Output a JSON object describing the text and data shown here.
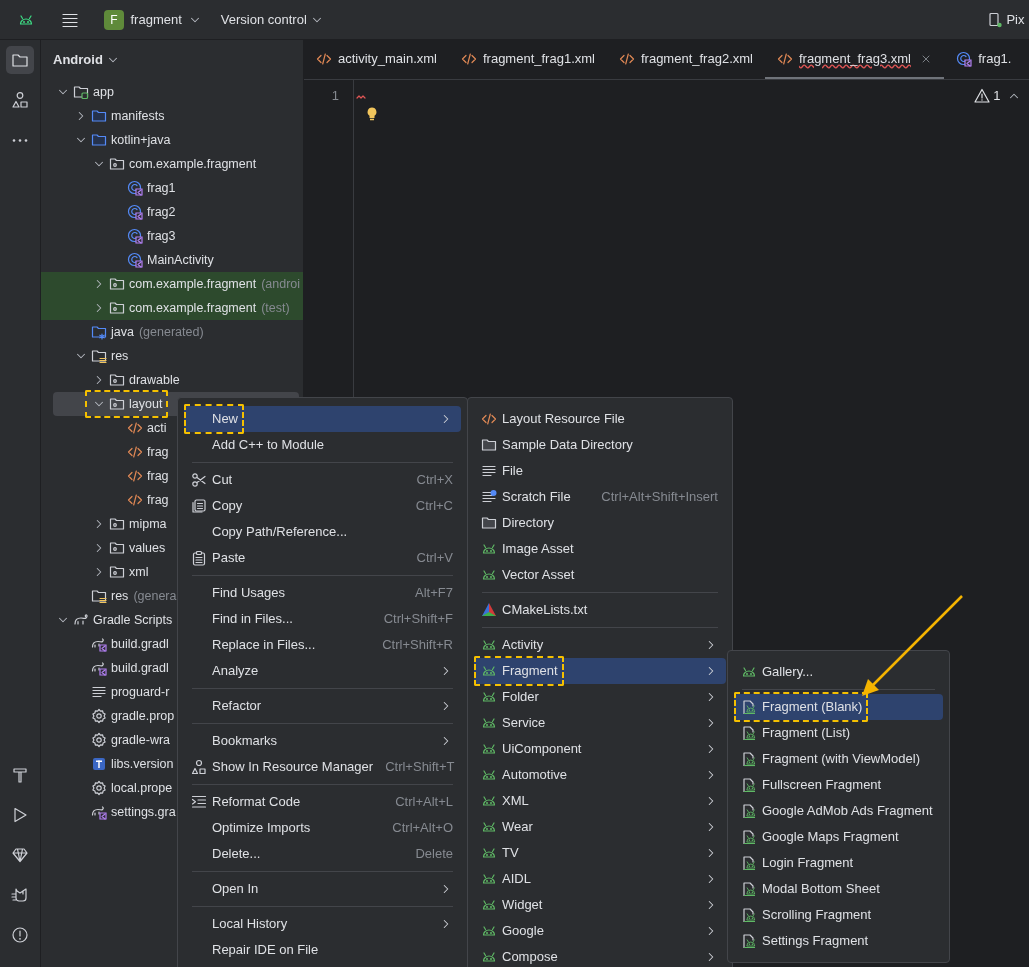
{
  "top_bar": {
    "project_badge": "F",
    "project": "fragment",
    "vcs": "Version control",
    "device": "Pix"
  },
  "tool_strip": [
    {
      "selected": true
    },
    {
      "selected": false
    },
    {
      "selected": false
    }
  ],
  "project_panel": {
    "title": "Android",
    "tree": [
      {
        "label": "app",
        "kind": "module",
        "expanded": true,
        "selected": false,
        "children": [
          {
            "label": "manifests",
            "kind": "source-folder",
            "expanded": false,
            "selected": false
          },
          {
            "label": "kotlin+java",
            "kind": "source-folder",
            "expanded": true,
            "selected": false,
            "children": [
              {
                "label": "com.example.fragment",
                "kind": "package",
                "expanded": true,
                "selected": false,
                "tinted": false,
                "children": [
                  {
                    "label": "frag1",
                    "kind": "class",
                    "selected": false
                  },
                  {
                    "label": "frag2",
                    "kind": "class",
                    "selected": false
                  },
                  {
                    "label": "frag3",
                    "kind": "class",
                    "selected": false
                  },
                  {
                    "label": "MainActivity",
                    "kind": "class",
                    "selected": false
                  }
                ]
              },
              {
                "label": "com.example.fragment",
                "suffix": "(androi",
                "kind": "package",
                "expanded": false,
                "selected": false,
                "tinted": true
              },
              {
                "label": "com.example.fragment",
                "suffix": "(test)",
                "kind": "package",
                "expanded": false,
                "selected": false,
                "tinted": true
              }
            ]
          },
          {
            "label": "java",
            "suffix": "(generated)",
            "kind": "generated-folder",
            "selected": false
          },
          {
            "label": "res",
            "kind": "res-folder",
            "expanded": true,
            "selected": false,
            "children": [
              {
                "label": "drawable",
                "kind": "package",
                "expanded": false,
                "selected": false
              },
              {
                "label": "layout",
                "kind": "package",
                "expanded": true,
                "selected": true,
                "callout": true,
                "children": [
                  {
                    "label": "acti",
                    "kind": "xml",
                    "selected": false
                  },
                  {
                    "label": "frag",
                    "kind": "xml",
                    "selected": false
                  },
                  {
                    "label": "frag",
                    "kind": "xml",
                    "selected": false
                  },
                  {
                    "label": "frag",
                    "kind": "xml",
                    "selected": false
                  }
                ]
              },
              {
                "label": "mipma",
                "kind": "package",
                "expanded": false,
                "selected": false
              },
              {
                "label": "values",
                "kind": "package",
                "expanded": false,
                "selected": false
              },
              {
                "label": "xml",
                "kind": "package",
                "expanded": false,
                "selected": false
              }
            ]
          },
          {
            "label": "res",
            "suffix": "(genera",
            "kind": "res-folder",
            "selected": false
          }
        ]
      },
      {
        "label": "Gradle Scripts",
        "kind": "gradle",
        "expanded": true,
        "selected": false,
        "children": [
          {
            "label": "build.gradl",
            "kind": "gradle-kts",
            "selected": false
          },
          {
            "label": "build.gradl",
            "kind": "gradle-kts",
            "selected": false
          },
          {
            "label": "proguard-r",
            "kind": "text",
            "selected": false
          },
          {
            "label": "gradle.prop",
            "kind": "properties",
            "selected": false
          },
          {
            "label": "gradle-wra",
            "kind": "properties",
            "selected": false
          },
          {
            "label": "libs.version",
            "kind": "toml",
            "selected": false
          },
          {
            "label": "local.prope",
            "kind": "properties",
            "selected": false
          },
          {
            "label": "settings.gra",
            "kind": "gradle-kts",
            "selected": false
          }
        ]
      }
    ]
  },
  "editor": {
    "tabs": [
      {
        "label": "activity_main.xml",
        "kind": "xml",
        "selected": false,
        "error": false
      },
      {
        "label": "fragment_frag1.xml",
        "kind": "xml",
        "selected": false,
        "error": false
      },
      {
        "label": "fragment_frag2.xml",
        "kind": "xml",
        "selected": false,
        "error": false
      },
      {
        "label": "fragment_frag3.xml",
        "kind": "xml",
        "selected": true,
        "error": true
      },
      {
        "label": "frag1.",
        "kind": "class",
        "selected": false,
        "error": false
      }
    ],
    "line_numbers": [
      "1"
    ],
    "warnings": "1"
  },
  "context_menu": [
    {
      "kind": "action",
      "label": "New",
      "submenu": true,
      "selected": true,
      "callout": true
    },
    {
      "kind": "action",
      "label": "Add C++ to Module",
      "selected": false
    },
    {
      "kind": "separator"
    },
    {
      "kind": "cut",
      "label": "Cut",
      "shortcut": "Ctrl+X",
      "selected": false
    },
    {
      "kind": "copy",
      "label": "Copy",
      "shortcut": "Ctrl+C",
      "selected": false
    },
    {
      "kind": "action",
      "label": "Copy Path/Reference...",
      "selected": false
    },
    {
      "kind": "paste",
      "label": "Paste",
      "shortcut": "Ctrl+V",
      "selected": false
    },
    {
      "kind": "separator"
    },
    {
      "kind": "action",
      "label": "Find Usages",
      "shortcut": "Alt+F7",
      "selected": false
    },
    {
      "kind": "action",
      "label": "Find in Files...",
      "shortcut": "Ctrl+Shift+F",
      "selected": false
    },
    {
      "kind": "action",
      "label": "Replace in Files...",
      "shortcut": "Ctrl+Shift+R",
      "selected": false
    },
    {
      "kind": "action",
      "label": "Analyze",
      "submenu": true,
      "selected": false
    },
    {
      "kind": "separator"
    },
    {
      "kind": "action",
      "label": "Refactor",
      "submenu": true,
      "selected": false
    },
    {
      "kind": "separator"
    },
    {
      "kind": "action",
      "label": "Bookmarks",
      "submenu": true,
      "selected": false
    },
    {
      "kind": "resources",
      "label": "Show In Resource Manager",
      "shortcut": "Ctrl+Shift+T",
      "selected": false
    },
    {
      "kind": "separator"
    },
    {
      "kind": "reformat",
      "label": "Reformat Code",
      "shortcut": "Ctrl+Alt+L",
      "selected": false
    },
    {
      "kind": "action",
      "label": "Optimize Imports",
      "shortcut": "Ctrl+Alt+O",
      "selected": false
    },
    {
      "kind": "action",
      "label": "Delete...",
      "shortcut": "Delete",
      "selected": false
    },
    {
      "kind": "separator"
    },
    {
      "kind": "action",
      "label": "Open In",
      "submenu": true,
      "selected": false
    },
    {
      "kind": "separator"
    },
    {
      "kind": "action",
      "label": "Local History",
      "submenu": true,
      "selected": false
    },
    {
      "kind": "action",
      "label": "Repair IDE on File",
      "selected": false
    }
  ],
  "new_menu": [
    {
      "kind": "xml",
      "label": "Layout Resource File",
      "selected": false
    },
    {
      "kind": "folder",
      "label": "Sample Data Directory",
      "selected": false
    },
    {
      "kind": "text",
      "label": "File",
      "selected": false
    },
    {
      "kind": "scratch",
      "label": "Scratch File",
      "shortcut": "Ctrl+Alt+Shift+Insert",
      "selected": false
    },
    {
      "kind": "folder",
      "label": "Directory",
      "selected": false
    },
    {
      "kind": "android",
      "label": "Image Asset",
      "selected": false
    },
    {
      "kind": "android",
      "label": "Vector Asset",
      "selected": false
    },
    {
      "kind": "separator"
    },
    {
      "kind": "cmake",
      "label": "CMakeLists.txt",
      "selected": false
    },
    {
      "kind": "separator"
    },
    {
      "kind": "android",
      "label": "Activity",
      "submenu": true,
      "selected": false
    },
    {
      "kind": "android",
      "label": "Fragment",
      "submenu": true,
      "selected": true,
      "callout": true
    },
    {
      "kind": "android",
      "label": "Folder",
      "submenu": true,
      "selected": false
    },
    {
      "kind": "android",
      "label": "Service",
      "submenu": true,
      "selected": false
    },
    {
      "kind": "android",
      "label": "UiComponent",
      "submenu": true,
      "selected": false
    },
    {
      "kind": "android",
      "label": "Automotive",
      "submenu": true,
      "selected": false
    },
    {
      "kind": "android",
      "label": "XML",
      "submenu": true,
      "selected": false
    },
    {
      "kind": "android",
      "label": "Wear",
      "submenu": true,
      "selected": false
    },
    {
      "kind": "android",
      "label": "TV",
      "submenu": true,
      "selected": false
    },
    {
      "kind": "android",
      "label": "AIDL",
      "submenu": true,
      "selected": false
    },
    {
      "kind": "android",
      "label": "Widget",
      "submenu": true,
      "selected": false
    },
    {
      "kind": "android",
      "label": "Google",
      "submenu": true,
      "selected": false
    },
    {
      "kind": "android",
      "label": "Compose",
      "submenu": true,
      "selected": false
    }
  ],
  "fragment_menu": [
    {
      "kind": "android",
      "label": "Gallery...",
      "selected": false
    },
    {
      "kind": "separator"
    },
    {
      "kind": "template",
      "label": "Fragment (Blank)",
      "selected": true,
      "callout": true
    },
    {
      "kind": "template",
      "label": "Fragment (List)",
      "selected": false
    },
    {
      "kind": "template",
      "label": "Fragment (with ViewModel)",
      "selected": false
    },
    {
      "kind": "template",
      "label": "Fullscreen Fragment",
      "selected": false
    },
    {
      "kind": "template",
      "label": "Google AdMob Ads Fragment",
      "selected": false
    },
    {
      "kind": "template",
      "label": "Google Maps Fragment",
      "selected": false
    },
    {
      "kind": "template",
      "label": "Login Fragment",
      "selected": false
    },
    {
      "kind": "template",
      "label": "Modal Bottom Sheet",
      "selected": false
    },
    {
      "kind": "template",
      "label": "Scrolling Fragment",
      "selected": false
    },
    {
      "kind": "template",
      "label": "Settings Fragment",
      "selected": false
    }
  ]
}
